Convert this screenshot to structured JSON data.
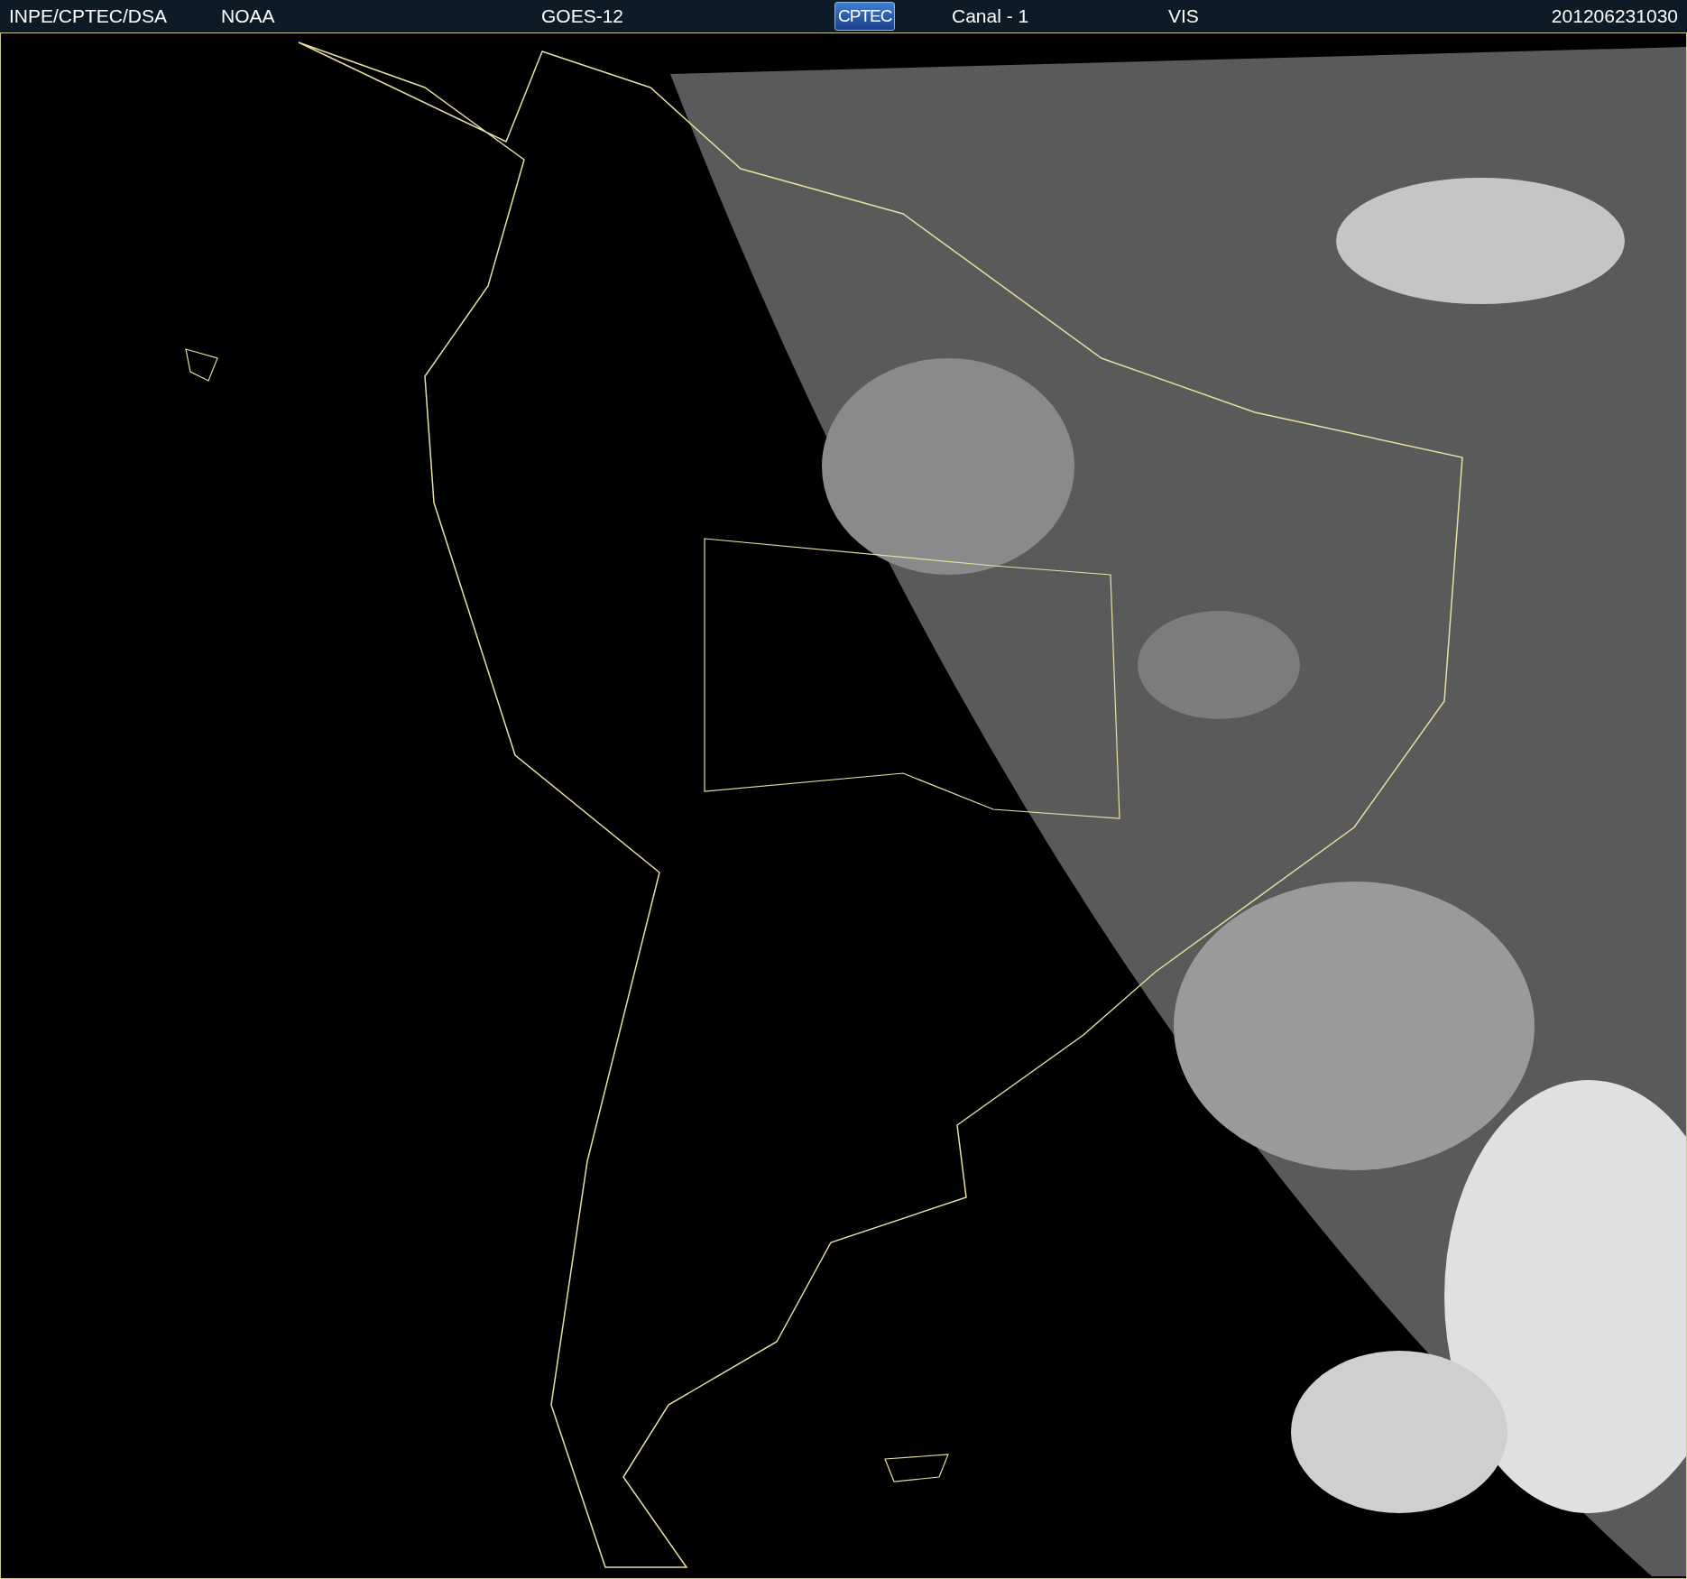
{
  "header": {
    "items": [
      {
        "kind": "text",
        "text": "INPE/CPTEC/DSA"
      },
      {
        "kind": "text",
        "text": "NOAA"
      },
      {
        "kind": "text",
        "text": "GOES-12"
      },
      {
        "kind": "logo",
        "text": "CPTEC"
      },
      {
        "kind": "text",
        "text": "Canal - 1"
      },
      {
        "kind": "text",
        "text": "VIS"
      },
      {
        "kind": "text",
        "text": "201206231030"
      }
    ]
  }
}
